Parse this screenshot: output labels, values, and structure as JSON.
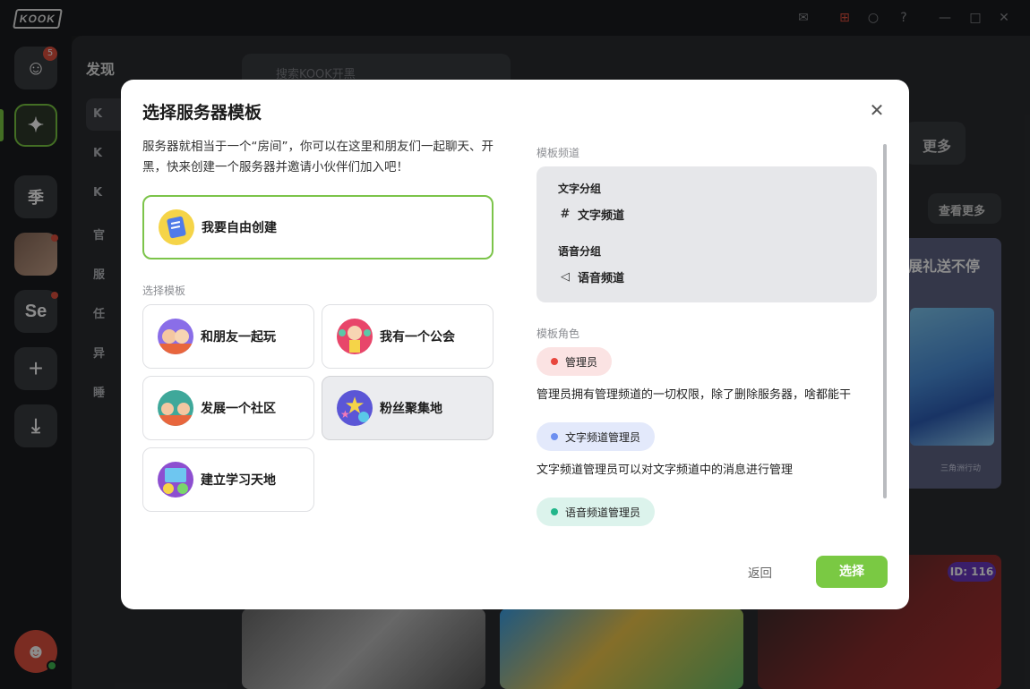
{
  "app": {
    "logo": "KOOK",
    "unread_badge": "5"
  },
  "rail": {
    "season_label": "季",
    "se_label": "Se"
  },
  "sidebar": {
    "title": "发现",
    "items": [
      "K",
      "K",
      "K",
      "官",
      "服",
      "任",
      "异",
      "睡"
    ]
  },
  "background": {
    "search_placeholder": "搜索KOOK开黑",
    "more_label": "更多",
    "view_more_label": "查看更多",
    "promo_title": "展礼送不停",
    "promo_id_tag": "ID: 116",
    "promo_brand": "三角洲行动"
  },
  "modal": {
    "title": "选择服务器模板",
    "intro": "服务器就相当于一个“房间”，你可以在这里和朋友们一起聊天、开黑，快来创建一个服务器并邀请小伙伴们加入吧！",
    "free_create_label": "我要自由创建",
    "templates_section_label": "选择模板",
    "templates": [
      {
        "label": "和朋友一起玩",
        "icon": "friends-icon"
      },
      {
        "label": "我有一个公会",
        "icon": "guild-icon"
      },
      {
        "label": "发展一个社区",
        "icon": "community-icon"
      },
      {
        "label": "粉丝聚集地",
        "icon": "star-fans-icon",
        "selected": true
      },
      {
        "label": "建立学习天地",
        "icon": "study-icon"
      }
    ],
    "channels_section_label": "模板频道",
    "text_group_label": "文字分组",
    "text_channel_label": "文字频道",
    "voice_group_label": "语音分组",
    "voice_channel_label": "语音频道",
    "roles_section_label": "模板角色",
    "roles": [
      {
        "name": "管理员",
        "color": "#e8473e",
        "bg": "#fbe3e3",
        "desc": "管理员拥有管理频道的一切权限，除了删除服务器，啥都能干"
      },
      {
        "name": "文字频道管理员",
        "color": "#6c8ff0",
        "bg": "#e3e9fb",
        "desc": "文字频道管理员可以对文字频道中的消息进行管理"
      },
      {
        "name": "语音频道管理员",
        "color": "#22b58a",
        "bg": "#dcf3ec",
        "desc": ""
      }
    ],
    "back_label": "返回",
    "select_label": "选择",
    "accent_color": "#7ac943"
  }
}
